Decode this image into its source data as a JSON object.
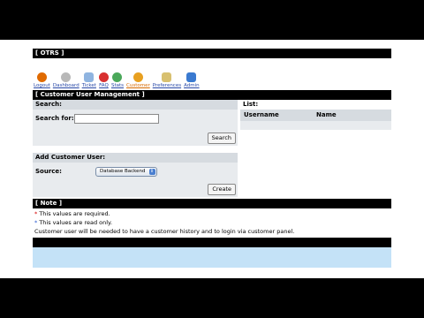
{
  "header": {
    "title": "[ OTRS ]"
  },
  "nav": {
    "items": [
      {
        "label": "Logout",
        "icon": "logout-icon",
        "color": "#e06a00",
        "active": false
      },
      {
        "label": "Dashboard",
        "icon": "dashboard-icon",
        "color": "#9a9a9a",
        "active": false
      },
      {
        "label": "Ticket",
        "icon": "ticket-icon",
        "color": "#5a8ac8",
        "active": false
      },
      {
        "label": "FAQ",
        "icon": "faq-icon",
        "color": "#d83030",
        "active": false
      },
      {
        "label": "Stats",
        "icon": "stats-icon",
        "color": "#4aa85a",
        "active": false
      },
      {
        "label": "Customer",
        "icon": "customer-icon",
        "color": "#e8a020",
        "active": true
      },
      {
        "label": "Preferences",
        "icon": "preferences-icon",
        "color": "#d8c070",
        "active": false
      },
      {
        "label": "Admin",
        "icon": "admin-icon",
        "color": "#3a7ad0",
        "active": false
      }
    ]
  },
  "page_title": "[ Customer User Management ]",
  "search": {
    "heading": "Search:",
    "label": "Search for:",
    "value": "",
    "button": "Search"
  },
  "list": {
    "heading": "List:",
    "columns": [
      "Username",
      "Name"
    ]
  },
  "add_customer": {
    "heading": "Add Customer User:",
    "source_label": "Source:",
    "source_value": "Database Backend",
    "button": "Create"
  },
  "note": {
    "title": "[ Note ]",
    "lines": [
      {
        "star": "*",
        "text": " This values are required."
      },
      {
        "star": "*",
        "text": " This values are read only."
      },
      {
        "star": "",
        "text": "Customer user will be needed to have a customer history and to login via customer panel."
      }
    ]
  }
}
